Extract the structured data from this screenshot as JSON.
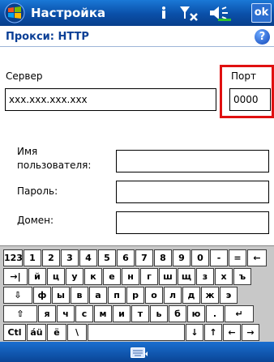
{
  "titlebar": {
    "title": "Настройка",
    "ok_label": "ok",
    "icons": [
      "windows-start-icon",
      "info-icon",
      "signal-off-icon",
      "volume-icon"
    ]
  },
  "header": {
    "title": "Прокси: HTTP",
    "help_icon": "help-icon",
    "help_symbol": "?"
  },
  "form": {
    "server_label": "Сервер",
    "server_value": "xxx.xxx.xxx.xxx",
    "port_label": "Порт",
    "port_value": "0000",
    "username_label": "Имя пользователя:",
    "password_label": "Пароль:",
    "domain_label": "Домен:",
    "username_value": "",
    "password_value": "",
    "domain_value": ""
  },
  "colors": {
    "titlebar": "#0a4fa8",
    "header_text": "#0b3f96",
    "highlight": "#e01010"
  },
  "keyboard": {
    "rows": [
      [
        "123",
        "1",
        "2",
        "3",
        "4",
        "5",
        "6",
        "7",
        "8",
        "9",
        "0",
        "-",
        "=",
        "←"
      ],
      [
        "→|",
        "й",
        "ц",
        "у",
        "к",
        "е",
        "н",
        "г",
        "ш",
        "щ",
        "з",
        "х",
        "ъ"
      ],
      [
        "⇩",
        "ф",
        "ы",
        "в",
        "а",
        "п",
        "р",
        "о",
        "л",
        "д",
        "ж",
        "э"
      ],
      [
        "⇧",
        "я",
        "ч",
        "с",
        "м",
        "и",
        "т",
        "ь",
        "б",
        "ю",
        ".",
        "↵"
      ],
      [
        "Ctl",
        "áü",
        "ё",
        "\\",
        " ",
        "↓",
        "↑",
        "←",
        "→"
      ]
    ]
  },
  "bottombar": {
    "icon": "keyboard-icon"
  }
}
